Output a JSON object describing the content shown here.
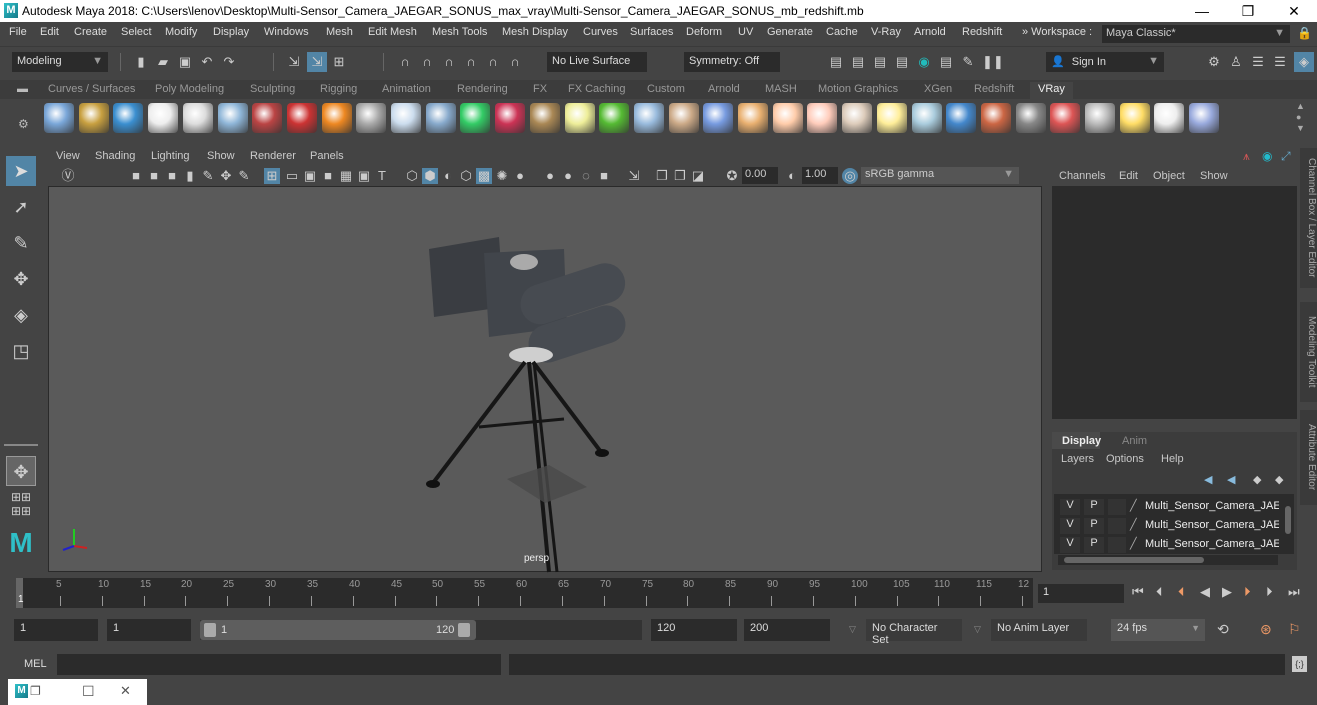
{
  "window": {
    "title": "Autodesk Maya 2018: C:\\Users\\lenov\\Desktop\\Multi-Sensor_Camera_JAEGAR_SONUS_max_vray\\Multi-Sensor_Camera_JAEGAR_SONUS_mb_redshift.mb",
    "logo_letter": "M",
    "minimize": "—",
    "restore": "❐",
    "close": "✕"
  },
  "menubar": {
    "items": [
      "File",
      "Edit",
      "Create",
      "Select",
      "Modify",
      "Display",
      "Windows",
      "Mesh",
      "Edit Mesh",
      "Mesh Tools",
      "Mesh Display",
      "Curves",
      "Surfaces",
      "Deform",
      "UV",
      "Generate",
      "Cache",
      "V-Ray",
      "Arnold",
      "Redshift"
    ],
    "workspace_label": "» Workspace :",
    "workspace_value": "Maya Classic*"
  },
  "status_line": {
    "mode": "Modeling",
    "live_surface": "No Live Surface",
    "symmetry": "Symmetry: Off",
    "sign_in": "Sign In"
  },
  "shelf": {
    "tabs": [
      "Curves / Surfaces",
      "Poly Modeling",
      "Sculpting",
      "Rigging",
      "Animation",
      "Rendering",
      "FX",
      "FX Caching",
      "Custom",
      "Arnold",
      "MASH",
      "Motion Graphics",
      "XGen",
      "Redshift",
      "VRay"
    ],
    "active_tab": "VRay",
    "icons": [
      "vray-save-icon",
      "vray-folder-icon",
      "vray-list-icon",
      "vray-logo-icon",
      "vray-doc-icon",
      "vray-sphere-stand-icon",
      "vray-camera-icon",
      "vray-spheres-icon",
      "vray-fire-icon",
      "vray-proxy-icon",
      "vray-box-icon",
      "vray-cone-icon",
      "vray-light-plane-icon",
      "vray-mesh-icon",
      "vray-texture-icon",
      "vray-dome-icon",
      "vray-grass-icon",
      "vray-fur-icon",
      "vray-curve-icon",
      "vray-globe-icon",
      "vray-dome-light-icon",
      "vray-spot-icon",
      "vray-sphere-light-icon",
      "vray-ies-icon",
      "vray-sun-icon",
      "vray-plane-icon",
      "vray-material-icon",
      "vray-mtl-split-icon",
      "vray-checker-icon",
      "vray-vfb-icon",
      "vray-settings-icon",
      "vray-light-lister-icon",
      "vray-cloud-icon",
      "vray-help-icon"
    ]
  },
  "viewport": {
    "menu": [
      "View",
      "Shading",
      "Lighting",
      "Show",
      "Renderer",
      "Panels"
    ],
    "exposure": "0.00",
    "gamma": "1.00",
    "color_space": "sRGB gamma",
    "camera_label": "persp"
  },
  "channel_box": {
    "menu": [
      "Channels",
      "Edit",
      "Object",
      "Show"
    ],
    "side_tab": "Channel Box / Layer Editor"
  },
  "side_tabs": [
    "Modeling Toolkit",
    "Attribute Editor"
  ],
  "layer_editor": {
    "tabs": [
      "Display",
      "Anim"
    ],
    "active_tab": "Display",
    "menu": [
      "Layers",
      "Options",
      "Help"
    ],
    "layers": [
      {
        "v": "V",
        "p": "P",
        "name": "Multi_Sensor_Camera_JAEGA"
      },
      {
        "v": "V",
        "p": "P",
        "name": "Multi_Sensor_Camera_JAEGA"
      },
      {
        "v": "V",
        "p": "P",
        "name": "Multi_Sensor_Camera_JAEGA"
      }
    ]
  },
  "timeline": {
    "ticks": [
      "5",
      "10",
      "15",
      "20",
      "25",
      "30",
      "35",
      "40",
      "45",
      "50",
      "55",
      "60",
      "65",
      "70",
      "75",
      "80",
      "85",
      "90",
      "95",
      "100",
      "105",
      "110",
      "115",
      "12"
    ],
    "current_frame_marker": "1",
    "current_frame": "1"
  },
  "range": {
    "start": "1",
    "playback_start": "1",
    "slider_min": "1",
    "slider_max": "120",
    "playback_end": "120",
    "end": "200",
    "character_set": "No Character Set",
    "anim_layer": "No Anim Layer",
    "fps": "24 fps"
  },
  "command_line": {
    "lang": "MEL"
  },
  "taskbar": {
    "restore": "❐",
    "maximize": "☐",
    "close": "✕"
  }
}
